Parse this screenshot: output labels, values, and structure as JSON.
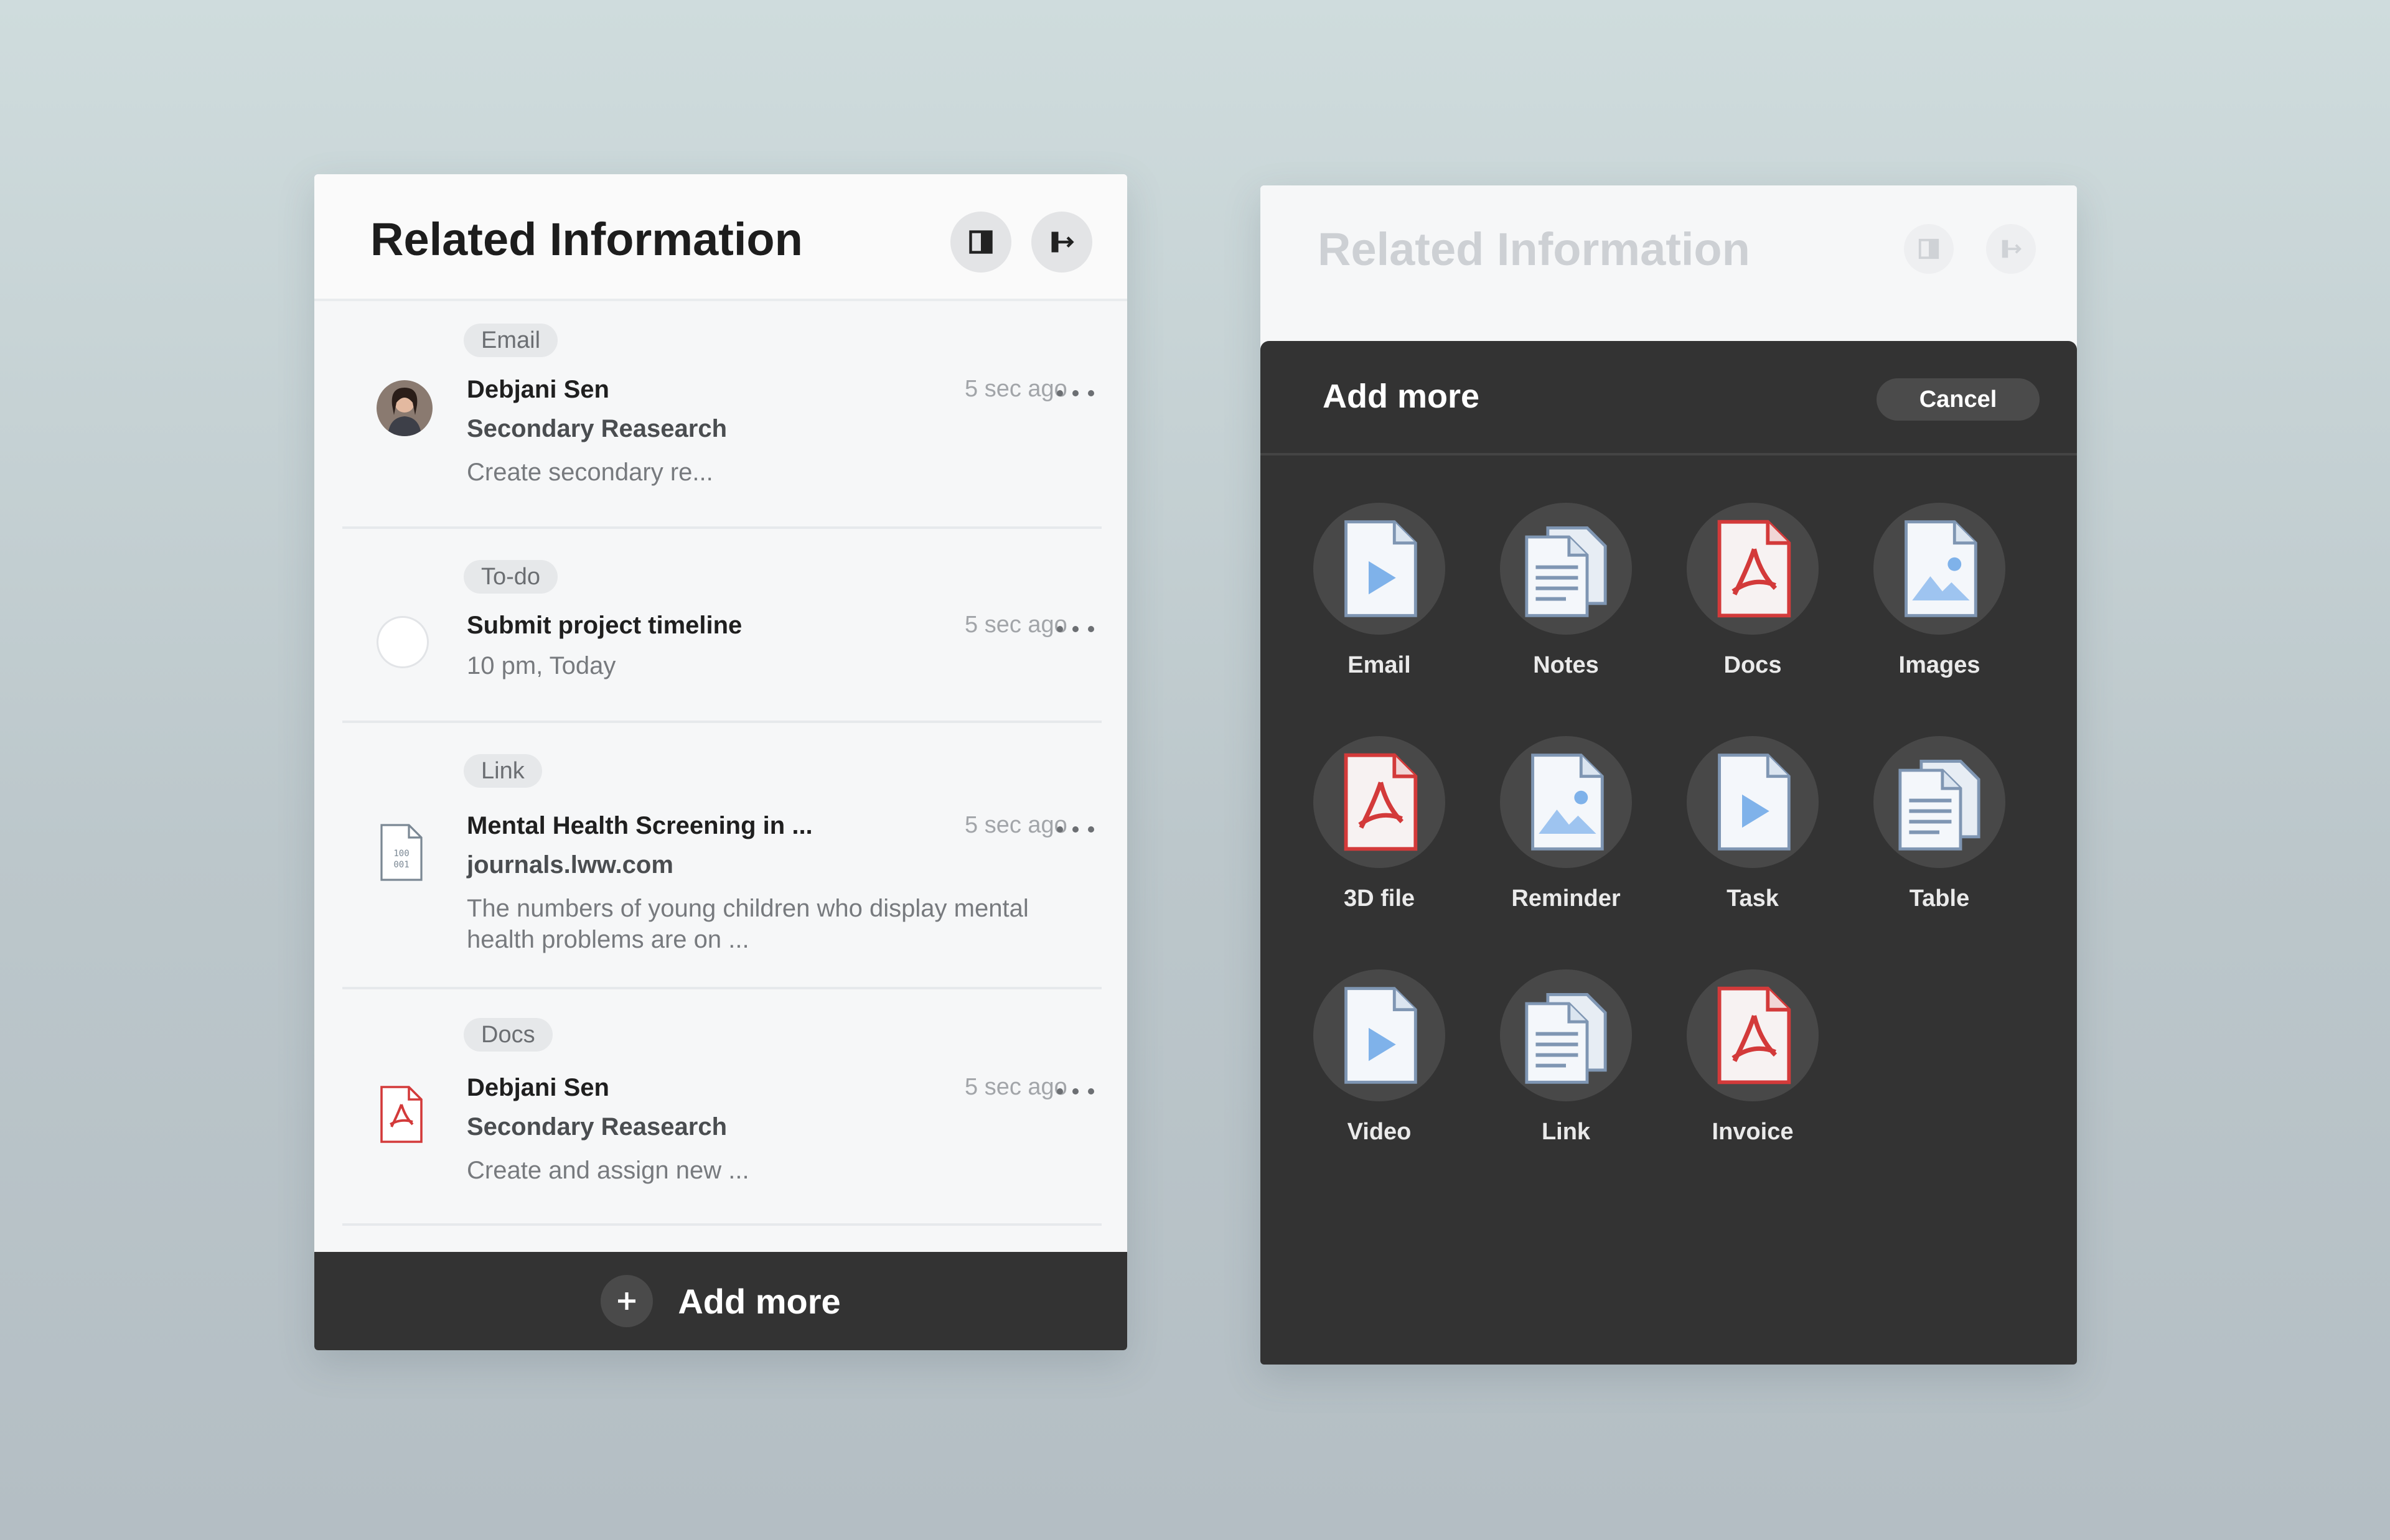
{
  "left_panel": {
    "title": "Related Information",
    "items": [
      {
        "tag": "Email",
        "name": "Debjani Sen",
        "sub": "Secondary Reasearch",
        "desc": "Create secondary re...",
        "time": "5 sec ago",
        "lead_icon": "avatar"
      },
      {
        "tag": "To-do",
        "name": "Submit project timeline",
        "sub": "10 pm, Today",
        "time": "5 sec ago",
        "lead_icon": "checkbox-circle"
      },
      {
        "tag": "Link",
        "name": "Mental Health Screening in ...",
        "sub": "journals.lww.com",
        "desc": "The numbers of young children who display mental health problems are on  ...",
        "time": "5 sec ago",
        "lead_icon": "binary-file-icon"
      },
      {
        "tag": "Docs",
        "name": "Debjani Sen",
        "sub": "Secondary Reasearch",
        "desc": "Create and assign new ...",
        "time": "5 sec ago",
        "lead_icon": "pdf-icon"
      }
    ],
    "add_more_label": "Add more"
  },
  "right_panel": {
    "title": "Related Information",
    "sheet_title": "Add more",
    "cancel_label": "Cancel",
    "options": [
      {
        "label": "Email",
        "icon": "video-file-icon"
      },
      {
        "label": "Notes",
        "icon": "notes-file-icon"
      },
      {
        "label": "Docs",
        "icon": "pdf-file-icon"
      },
      {
        "label": "Images",
        "icon": "image-file-icon"
      },
      {
        "label": "3D file",
        "icon": "pdf-file-icon"
      },
      {
        "label": "Reminder",
        "icon": "image-file-icon"
      },
      {
        "label": "Task",
        "icon": "video-file-icon"
      },
      {
        "label": "Table",
        "icon": "notes-file-icon"
      },
      {
        "label": "Video",
        "icon": "video-file-icon"
      },
      {
        "label": "Link",
        "icon": "notes-file-icon"
      },
      {
        "label": "Invoice",
        "icon": "pdf-file-icon"
      }
    ]
  },
  "colors": {
    "accent_dark": "#333333",
    "pdf_red": "#d33a3a",
    "file_blue": "#7fb2ea"
  }
}
